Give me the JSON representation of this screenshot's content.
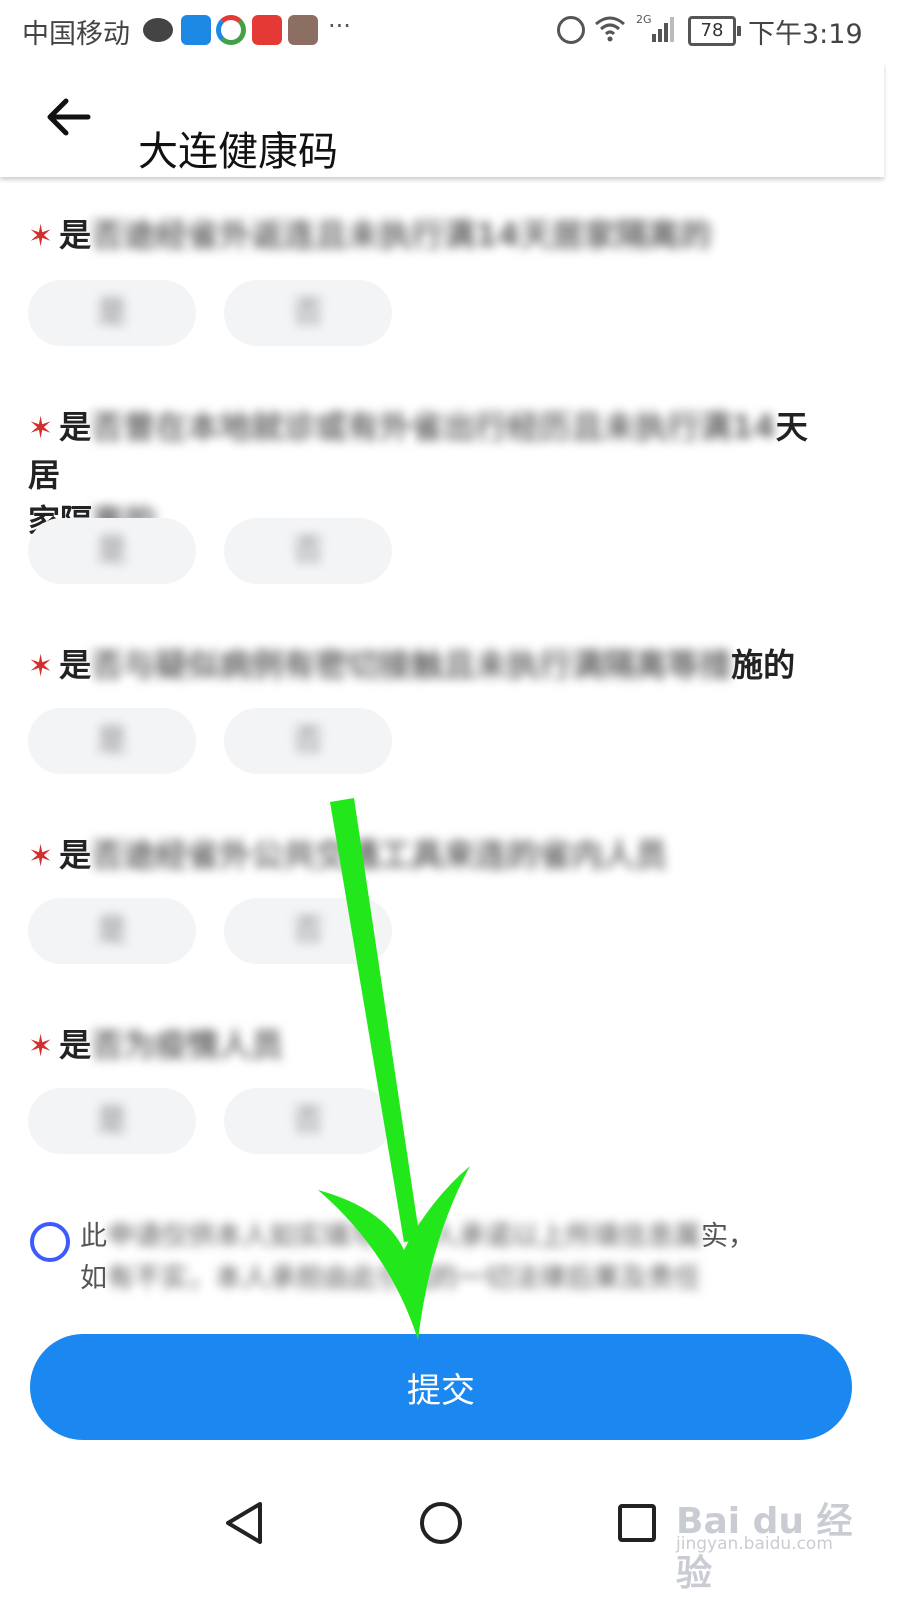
{
  "status_bar": {
    "carrier": "中国移动",
    "more": "···",
    "network": "2G",
    "battery": "78",
    "time": "下午3:19"
  },
  "app_bar": {
    "title": "大连健康码"
  },
  "questions": [
    {
      "star": "✶",
      "prefix": "是",
      "rest": "否途经省外返连且未执行满14天居家隔离的",
      "tail": "",
      "yes": "是",
      "no": "否"
    },
    {
      "star": "✶",
      "prefix": "是",
      "rest": "否曾在本地就诊或有外省出行经历且未执行满14",
      "tail": "天居",
      "line2_prefix": "家隔",
      "line2_rest": "离的",
      "yes": "是",
      "no": "否"
    },
    {
      "star": "✶",
      "prefix": "是",
      "rest": "否与疑似病例有密切接触且未执行满隔离等措",
      "tail": "施的",
      "yes": "是",
      "no": "否"
    },
    {
      "star": "✶",
      "prefix": "是",
      "rest": "否途经省外公共交通工具来连的省内人员",
      "tail": "",
      "yes": "是",
      "no": "否"
    },
    {
      "star": "✶",
      "prefix": "是",
      "rest": "否为疫情人员",
      "tail": "",
      "yes": "是",
      "no": "否"
    }
  ],
  "agreement": {
    "line1_start": "此",
    "line1_blur": "申请仅供本人如实填写，本人承诺以上所填信息属",
    "line1_end": "实，",
    "line2_start": "如",
    "line2_blur": "有不实，本人承担由此引起的一切法律后果及责任"
  },
  "submit": {
    "label": "提交"
  },
  "annotation": {
    "color": "#22e81b"
  },
  "watermark": {
    "main": "Bai du 经验",
    "sub": "jingyan.baidu.com"
  }
}
